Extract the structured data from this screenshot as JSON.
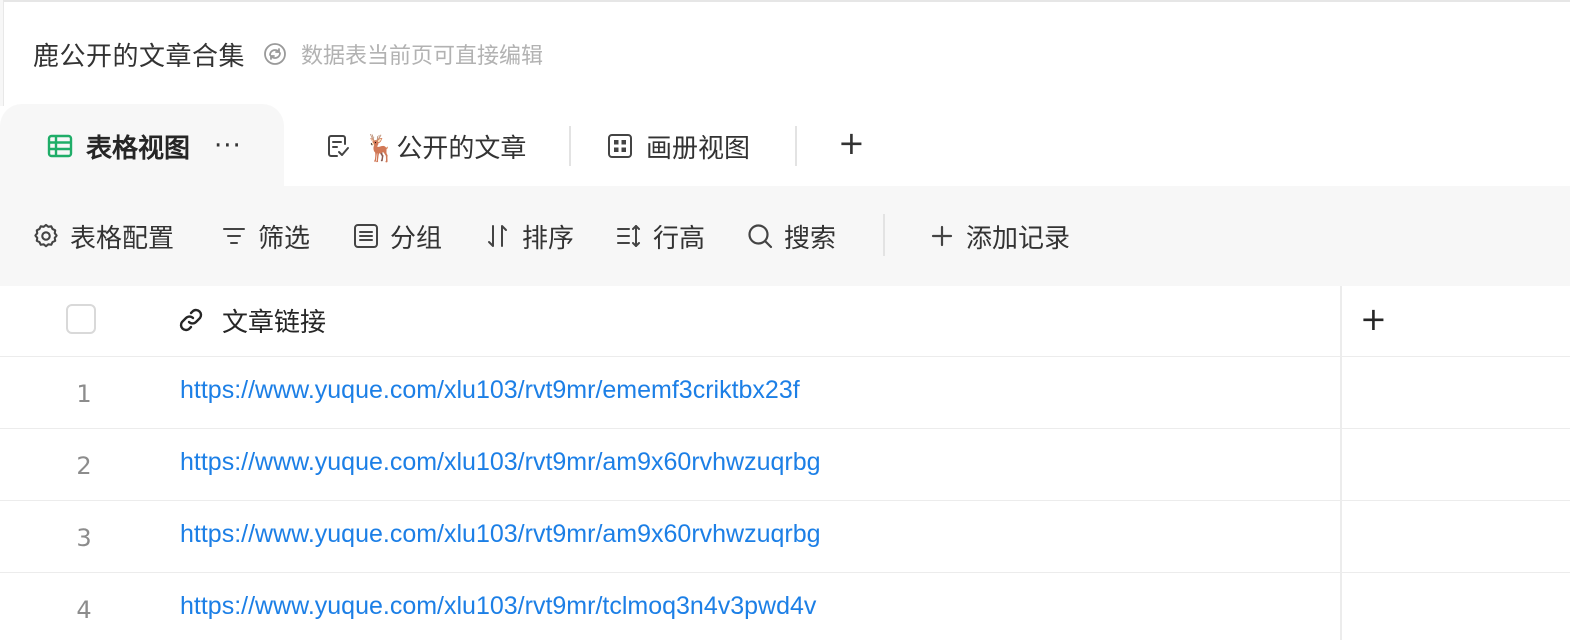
{
  "header": {
    "title": "鹿公开的文章合集",
    "subtitle": "数据表当前页可直接编辑"
  },
  "tabs": [
    {
      "label": "表格视图",
      "icon": "grid-table-icon",
      "active": true
    },
    {
      "label": "🦌公开的文章",
      "icon": "form-doc-icon",
      "active": false
    },
    {
      "label": "画册视图",
      "icon": "gallery-icon",
      "active": false
    }
  ],
  "tab_more": "···",
  "add_tab": "+",
  "toolbar": {
    "config": "表格配置",
    "filter": "筛选",
    "group": "分组",
    "sort": "排序",
    "row_height": "行高",
    "search": "搜索",
    "add_record": "添加记录"
  },
  "table": {
    "column_header": "文章链接",
    "add_column": "+",
    "rows": [
      {
        "num": "1",
        "link": "https://www.yuque.com/xlu103/rvt9mr/ememf3criktbx23f"
      },
      {
        "num": "2",
        "link": "https://www.yuque.com/xlu103/rvt9mr/am9x60rvhwzuqrbg"
      },
      {
        "num": "3",
        "link": "https://www.yuque.com/xlu103/rvt9mr/am9x60rvhwzuqrbg"
      },
      {
        "num": "4",
        "link": "https://www.yuque.com/xlu103/rvt9mr/tclmoq3n4v3pwd4v"
      }
    ]
  },
  "colors": {
    "accent_green": "#1fad68",
    "link_blue": "#1c7fe6"
  }
}
